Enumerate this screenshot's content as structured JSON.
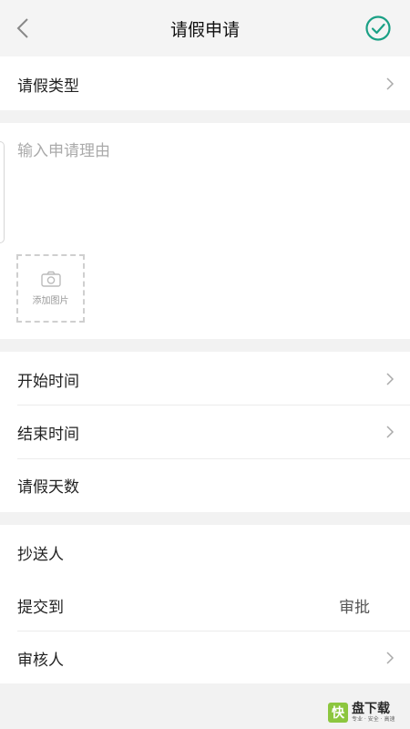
{
  "header": {
    "title": "请假申请",
    "back_icon": "chevron-left-icon",
    "confirm_icon": "check-circle-icon",
    "accent": "#1aa085"
  },
  "leave_type": {
    "label": "请假类型"
  },
  "reason": {
    "placeholder": "输入申请理由",
    "add_photo_label": "添加图片"
  },
  "time": {
    "start_label": "开始时间",
    "end_label": "结束时间",
    "days_label": "请假天数"
  },
  "routing": {
    "cc_label": "抄送人",
    "submit_to_label": "提交到",
    "submit_to_value": "审批",
    "reviewer_label": "审核人"
  },
  "watermark": {
    "logo_char": "快",
    "name": "盘下载",
    "slogan": "专业 · 安全 · 高速"
  }
}
